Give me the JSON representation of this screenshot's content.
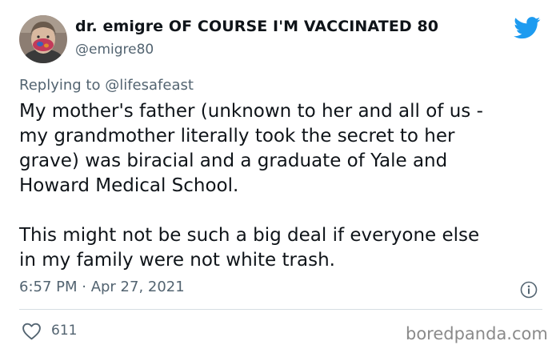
{
  "author": {
    "display_name": "dr. emigre OF COURSE I'M VACCINATED 80",
    "handle": "@emigre80",
    "avatar_icon": "profile-avatar"
  },
  "brand_icon": "twitter-bird-icon",
  "brand_color": "#1d9bf0",
  "reply": {
    "prefix": "Replying to",
    "handle": "@lifesafeast"
  },
  "body": {
    "paragraph1": [
      "My mother's father (unknown to her and all of us -",
      "my grandmother literally took the secret to her",
      "grave) was biracial and a graduate of Yale and",
      "Howard Medical School."
    ],
    "paragraph2": [
      "This might not be such a big deal if everyone else",
      "in my family were not white trash."
    ]
  },
  "timestamp": "6:57 PM · Apr 27, 2021",
  "info_icon": "info-icon",
  "likes": {
    "icon": "heart-icon",
    "count": "611"
  },
  "watermark": "boredpanda.com"
}
